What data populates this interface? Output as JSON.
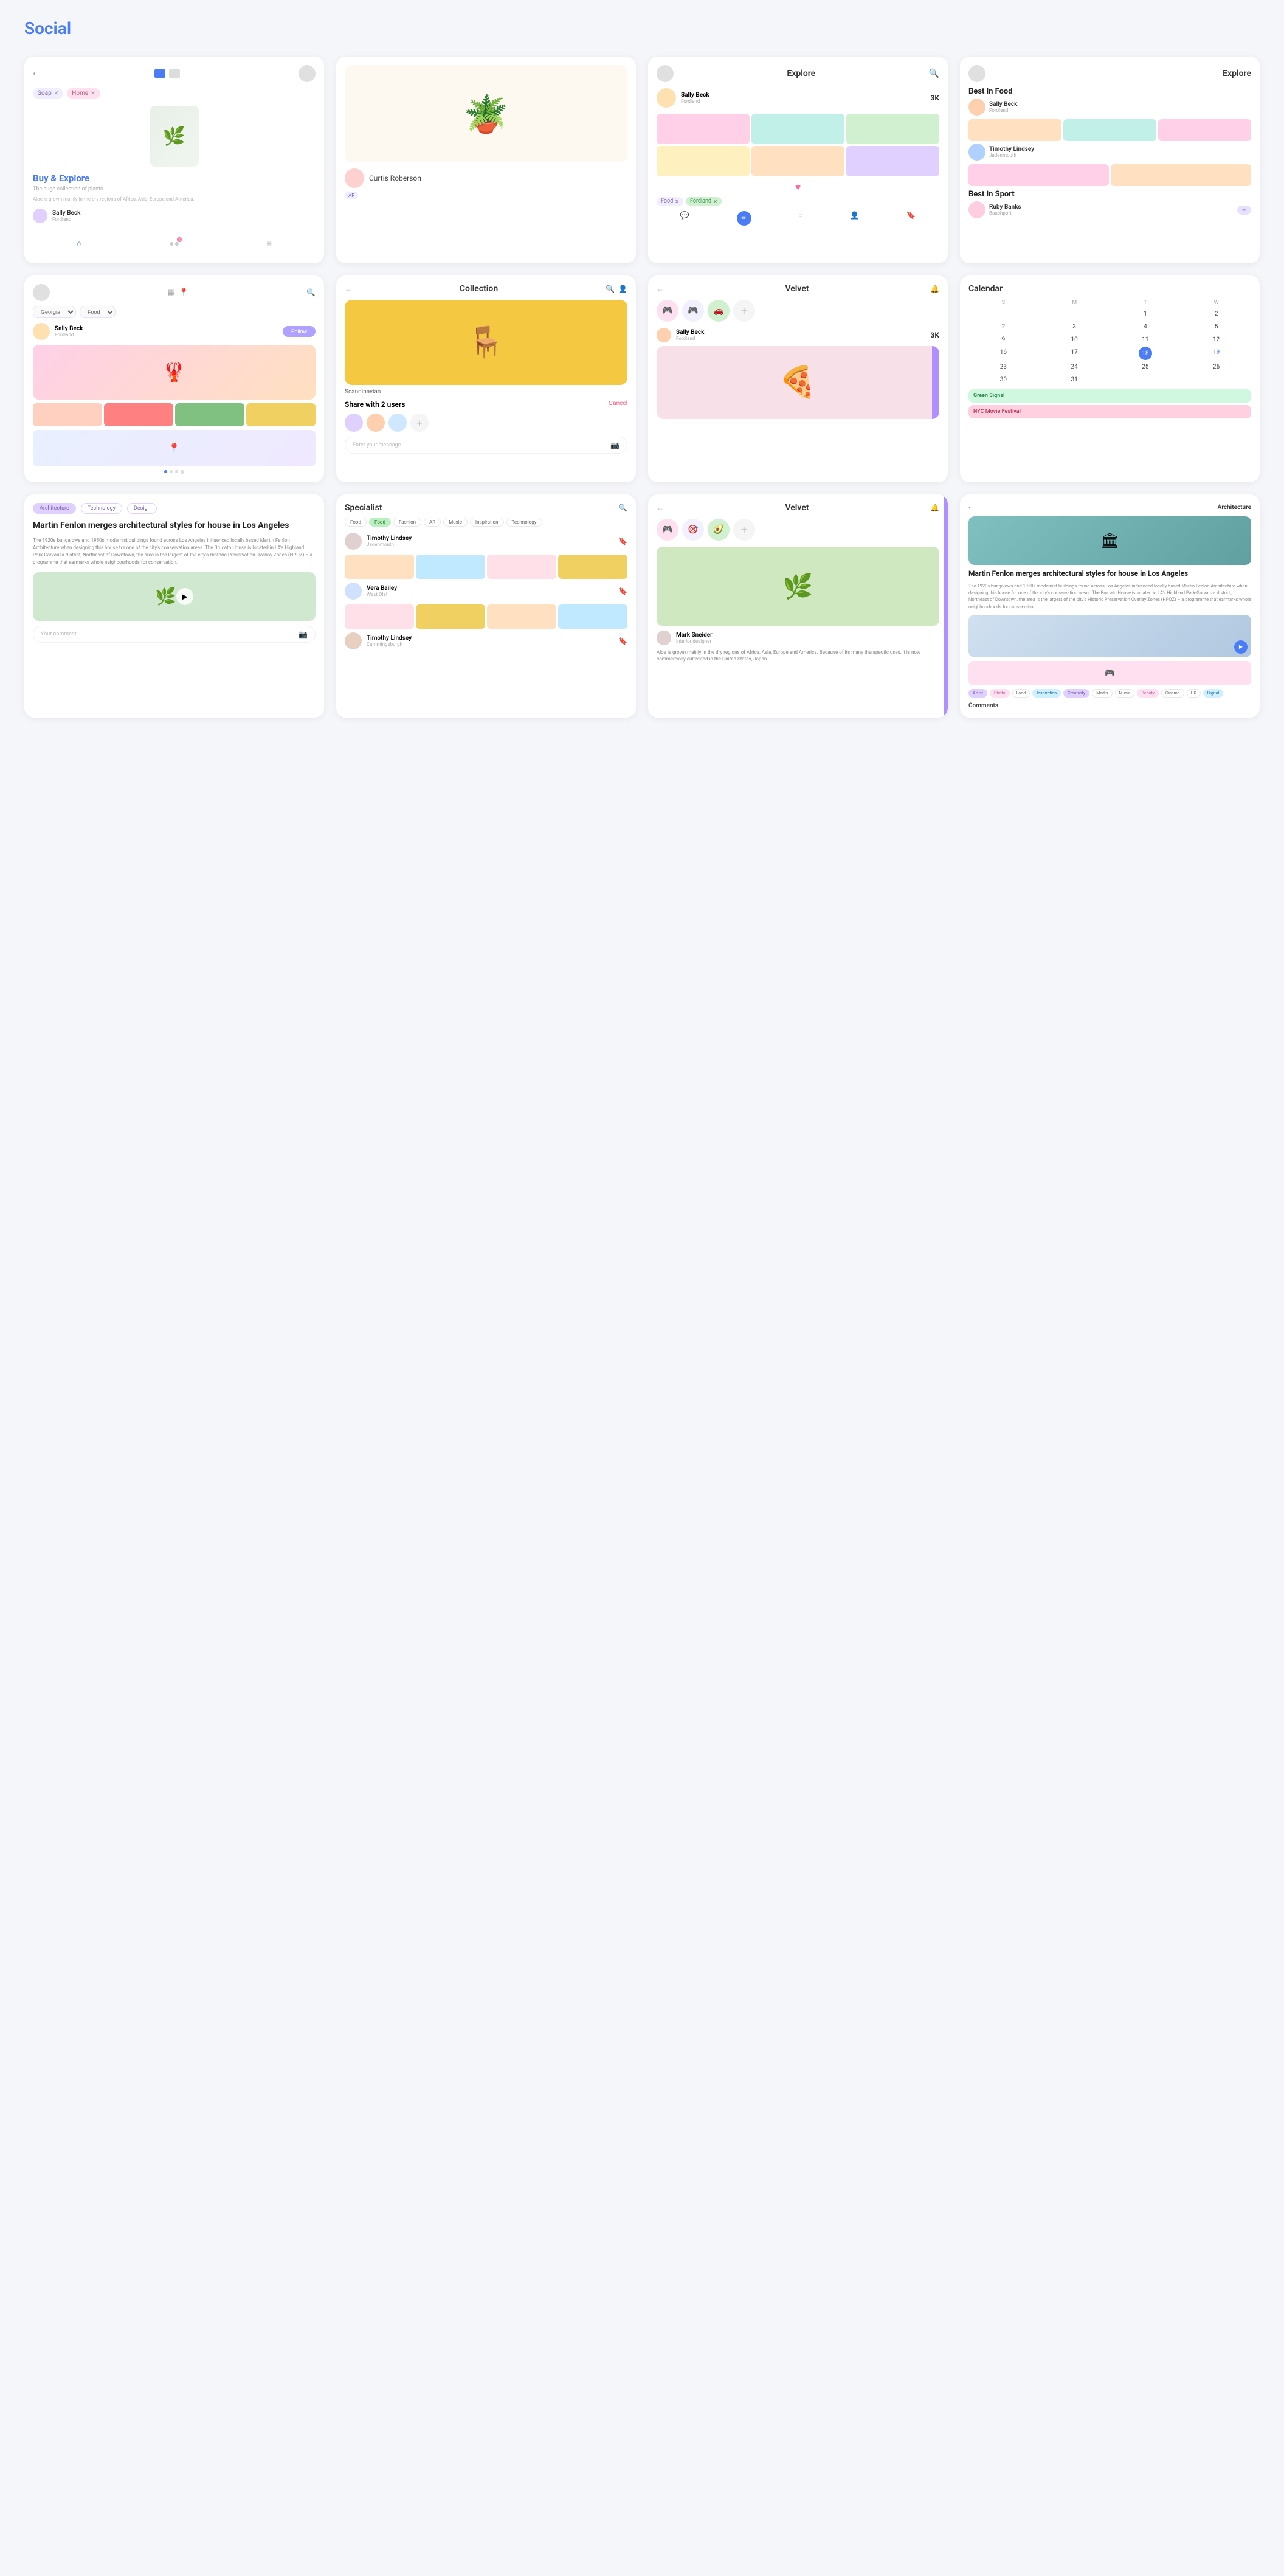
{
  "page": {
    "title": "Social"
  },
  "row1": {
    "card1": {
      "back": "‹",
      "title": "Buy & Explore",
      "subtitle": "The huge collection of plants",
      "description": "Aloe is grown mainly in the dry regions of Africa, Asia, Europe and America.",
      "tag1": "Soap",
      "tag2": "Home",
      "user_name": "Sally Beck",
      "user_sub": "Fordland",
      "emoji": "🌿"
    },
    "card2": {
      "person_name": "Curtis Roberson",
      "section_label": "AF",
      "emoji": "🪴"
    },
    "card3": {
      "title": "Explore",
      "user_name": "Sally Beck",
      "user_sub": "Fordland",
      "count": "3K",
      "tag1": "Food",
      "tag2": "Fordland",
      "emoji_heart": "♥"
    },
    "card4": {
      "title": "Explore",
      "section_food": "Best in Food",
      "food_user1_name": "Sally Beck",
      "food_user1_sub": "Fordland",
      "section_sport": "Best in Sport",
      "sport_user1_name": "Ruby Banks",
      "sport_user1_sub": "Bauchport"
    }
  },
  "row2": {
    "card5": {
      "filter1": "Georgia",
      "filter2": "Food",
      "user_name": "Sally Beck",
      "user_sub": "Fordland",
      "follow_label": "Follow"
    },
    "card6": {
      "title": "Collection",
      "chair_label": "Scandinavian",
      "share_title": "Share with 2 users",
      "cancel_label": "Cancel",
      "message_placeholder": "Enter your message"
    },
    "card7": {
      "title": "Velvet",
      "user_name": "Sally Beck",
      "user_sub": "Fordland",
      "count": "3K",
      "food_emoji": "🍕"
    },
    "card8": {
      "title": "Calendar",
      "days": [
        "S",
        "M",
        "T",
        "W"
      ],
      "week1": [
        "",
        "",
        "1",
        "2"
      ],
      "week2": [
        "2",
        "3",
        "4",
        "5"
      ],
      "week3": [
        "9",
        "10",
        "11",
        "12"
      ],
      "week4": [
        "16",
        "17",
        "18",
        "19"
      ],
      "week5": [
        "23",
        "24",
        "25",
        "26"
      ],
      "week6": [
        "30",
        "31",
        "",
        ""
      ],
      "today": "18",
      "event1": "Green Signal",
      "event2": "NYC Movie Festival"
    }
  },
  "row3": {
    "card9": {
      "tab1": "Architecture",
      "tab2": "Technology",
      "tab3": "Design",
      "title": "Martin Fenlon merges architectural styles for house in Los Angeles",
      "body": "The 1920s bungalows and 1950s modernist buildings found across Los Angeles influenced locally based Martin Fenlon Architecture when designing this house for one of the city's conservation areas. The Brucato House is located in LA's Highland Park-Garvanza district, Northeast of Downtown, the area is the largest of the city's Historic Preservation Overlay Zones (HPOZ) – a programme that earmarks whole neighbourhoods for conservation.",
      "comment_placeholder": "Your comment",
      "emoji": "🌿"
    },
    "card10": {
      "title": "Specialist",
      "tag1": "Food",
      "tag2": "Food",
      "tag3": "Fashion",
      "tag4": "AR",
      "tag5": "Music",
      "tag6": "Inspiration",
      "tag7": "Technology",
      "person1_name": "Timothy Lindsey",
      "person1_sub": "Jadenmouth",
      "person2_name": "Vera Bailey",
      "person2_sub": "West Olaf",
      "person3_name": "Timothy Lindsey",
      "person3_sub": "Cummingsburgh"
    },
    "card11": {
      "title": "Velvet",
      "user_name": "Mark Sneider",
      "user_sub": "Interior designer",
      "desc": "Aloe is grown mainly in the dry regions of Africa, Asia, Europe and America. Because of its many therapeutic uses, it is now commercially cultivated in the United States, Japan.",
      "emoji": "🌿"
    },
    "card12": {
      "back": "‹",
      "tab1": "Architecture",
      "article_title": "Martin Fenlon merges architectural styles for house in Los Angeles",
      "article_body": "The 1920s bungalows and 1950s modernist buildings found across Los Angeles influenced locally based Martin Fenlon Architecture when designing this house for one of the city's conservation areas. The Brucato House is located in LA's Highland Park-Garvanza district, Northeast of Downtown, the area is the largest of the city's Historic Preservation Overlay Zones (HPOZ) – a programme that earmarks whole neighbourhoods for conservation.",
      "tag_artist": "Artist",
      "tag_photo": "Photo",
      "tag_food": "Food",
      "tag_inspiration": "Inspiration",
      "tag_creativity": "Creativity",
      "tag_media": "Media",
      "tag_music": "Music",
      "tag_beauty": "Beauty",
      "tag_cinema": "Cinema",
      "tag_ux": "UX",
      "tag_digital": "Digital",
      "comments_label": "Comments"
    }
  }
}
